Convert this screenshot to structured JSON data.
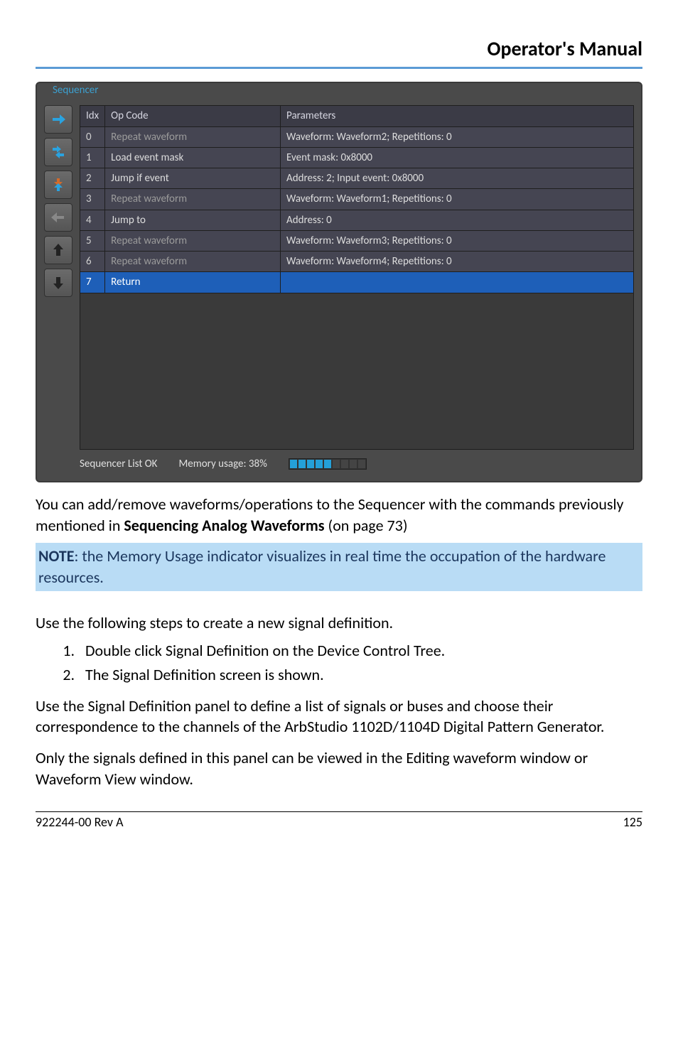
{
  "header": {
    "title": "Operator's Manual"
  },
  "screenshot": {
    "group_label": "Sequencer",
    "columns": {
      "idx": "Idx",
      "op": "Op Code",
      "params": "Parameters"
    },
    "rows": [
      {
        "idx": "0",
        "op": "Repeat waveform",
        "params": "Waveform: Waveform2; Repetitions: 0",
        "dim": true
      },
      {
        "idx": "1",
        "op": "Load event mask",
        "params": "Event mask: 0x8000"
      },
      {
        "idx": "2",
        "op": "Jump if event",
        "params": "Address: 2; Input event: 0x8000"
      },
      {
        "idx": "3",
        "op": "Repeat waveform",
        "params": "Waveform: Waveform1; Repetitions: 0",
        "dim": true
      },
      {
        "idx": "4",
        "op": "Jump to",
        "params": "Address: 0"
      },
      {
        "idx": "5",
        "op": "Repeat waveform",
        "params": "Waveform: Waveform3; Repetitions: 0",
        "dim": true
      },
      {
        "idx": "6",
        "op": "Repeat waveform",
        "params": "Waveform: Waveform4; Repetitions: 0",
        "dim": true
      },
      {
        "idx": "7",
        "op": "Return",
        "params": "",
        "selected": true
      }
    ],
    "status": {
      "list_ok": "Sequencer List OK",
      "memory_label": "Memory usage: 38%"
    },
    "icons": [
      "right-arrow-icon",
      "puzzle-icon",
      "swap-icon",
      "left-arrow-icon",
      "up-arrow-icon",
      "down-arrow-icon"
    ]
  },
  "body": {
    "p1a": "You can add/remove waveforms/operations to the Sequencer with the commands previously mentioned in ",
    "p1b": "Sequencing Analog Waveforms",
    "p1c": " (on page 73)",
    "note_label": "NOTE",
    "note_text": ": the Memory Usage indicator visualizes in real time the occupation of the hardware resources.",
    "p2": "Use the following steps to create a new signal definition.",
    "steps": [
      "Double click Signal Definition on the Device Control Tree.",
      "The Signal Definition screen is shown."
    ],
    "p3": "Use the Signal Definition panel to define a list of signals or buses and choose their correspondence to the channels of the ArbStudio 1102D/1104D Digital Pattern Generator.",
    "p4": "Only the signals defined in this panel can be viewed in the Editing waveform window or Waveform View window."
  },
  "footer": {
    "rev": "922244-00 Rev A",
    "page": "125"
  }
}
